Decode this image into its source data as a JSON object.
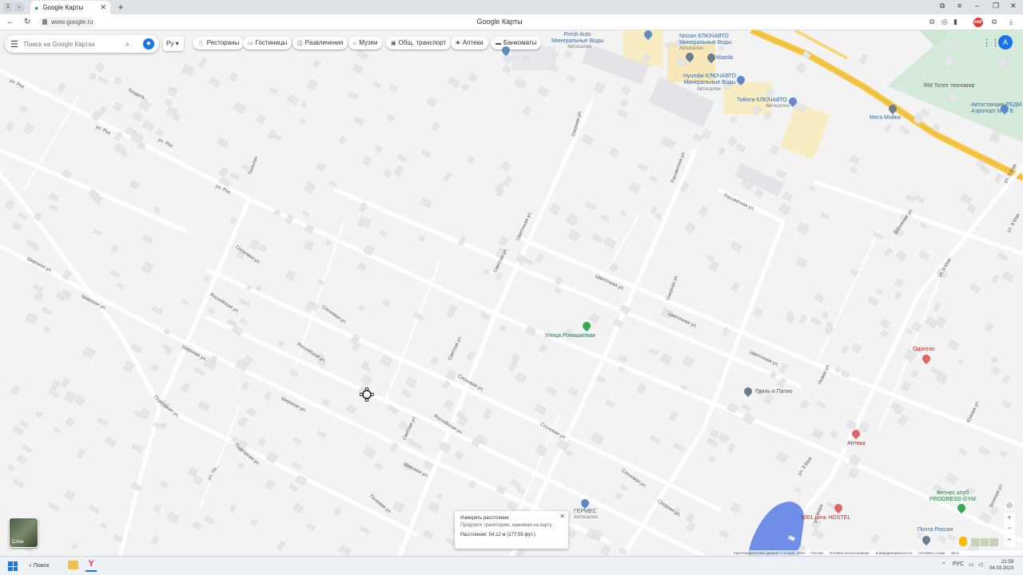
{
  "browser": {
    "tab_count": "1",
    "tab_title": "Google Карты",
    "url": "www.google.ru",
    "page_title": "Google Карты",
    "adblock_label": "ABP"
  },
  "search": {
    "placeholder": "Поиск на Google Картах"
  },
  "language_button": "Ру",
  "chips": [
    {
      "icon": "restaurant-icon",
      "glyph": "🍴",
      "label": "Рестораны"
    },
    {
      "icon": "hotel-icon",
      "glyph": "▭",
      "label": "Гостиницы"
    },
    {
      "icon": "entertainment-icon",
      "glyph": "◫",
      "label": "Развлечения"
    },
    {
      "icon": "museum-icon",
      "glyph": "⌂",
      "label": "Музеи"
    },
    {
      "icon": "transit-icon",
      "glyph": "▣",
      "label": "Общ. транспорт"
    },
    {
      "icon": "pharmacy-icon",
      "glyph": "✚",
      "label": "Аптеки"
    },
    {
      "icon": "atm-icon",
      "glyph": "▬",
      "label": "Банкоматы"
    }
  ],
  "account_initial": "A",
  "pois": {
    "fresh_auto": "Fresh Auto\nМинеральные Воды",
    "fresh_auto_sub": "Автосалон",
    "nissan": "Nissan КЛЮЧАВТО\nМинеральные Воды",
    "nissan_sub": "Автосалон",
    "mazda": "Mazda",
    "hyundai": "Hyundai КЛЮЧАВТО\nМинеральные Воды",
    "hyundai_sub": "Автосалон",
    "toyota": "Тойота КЛЮЧАВТО",
    "toyota_sub": "Автосалон",
    "mega_moika": "Мега Мойка",
    "rm_totek": "RM Тотех техномир",
    "avtostancia": "Автостанция РЕДМ\nАэропорт Мин В",
    "romashkovaya": "Улица Ромашковая",
    "odontis": "Одонтис",
    "gril": "Гриль и Патио",
    "apteka": "Аптека",
    "germes": "ГЕРМЕС",
    "germes_sub": "Автосалон",
    "hostel": "1001 ночь HOSTEL",
    "fitness": "Фитнес клуб\nPROGRESS-GYM",
    "pochta": "Почта России"
  },
  "streets": {
    "roz1": "ул. Роз",
    "roz2": "ул. Роз",
    "roz3": "ул. Роз",
    "roz4": "ул. Роз",
    "tendel": "Тендель...",
    "tulip": "Тюльпан",
    "sosnovaya1": "Сосновая ул.",
    "sosnovaya2": "Сосновая ул.",
    "sosnovaya3": "Сосновая ул.",
    "sosnovaya4": "Сосновая ул.",
    "sosnovaya5": "Сосновая ул.",
    "rossiyskaya1": "Российская ул.",
    "rossiyskaya2": "Российская ул.",
    "rossiyskaya3": "Российская ул.",
    "shirokaya1": "Широкая ул.",
    "shirokaya2": "Широкая ул.",
    "shirokaya3": "Широкая ул.",
    "shirokaya4": "Широкая ул.",
    "svetlaya1": "Светлая ул.",
    "svetlaya2": "Светлая ул.",
    "svetlaya3": "Светлая ул.",
    "cvetochnaya1": "Цветочная ул.",
    "cvetochnaya2": "Цветочная ул.",
    "cvetochnaya3": "Цветочная ул.",
    "cvetochnaya4": "Цветочная ул.",
    "rassvetnaya": "Рассветная ул.",
    "rassvetnaya2": "Рассветная ул.",
    "ozernaya": "Озерная ул.",
    "ozernaya2": "Озерная ул.",
    "podgornaya": "Подгорная ул.",
    "podgornaya2": "Подгорная ул.",
    "polevaya": "Полевая ул.",
    "srednyaya": "Средняя ул.",
    "mira": "ул. Мира",
    "may9_1": "ул. 9 Мая",
    "may9_2": "ул. 9 Мая",
    "may9_3": "ул. 9 Мая",
    "dorozhnaya": "Дорожная ул.",
    "yuzhnaya": "Южная ул.",
    "novaya": "Новая ул.",
    "zelenaya": "Зеленая ул.",
    "ulitsa": "ул. Ла..."
  },
  "measure": {
    "title": "Измерить расстояние",
    "subtitle": "Продлите траекторию, нажимая на карту",
    "distance": "Расстояние: 54,12 м (177,59 фут.)"
  },
  "layers_label": "Слои",
  "footer": {
    "copyright": "Картографические данные © Google, 2023",
    "country": "Россия",
    "terms": "Условия использования",
    "privacy": "Конфиденциальность",
    "feedback": "Оставить отзыв",
    "scale": "50 м"
  },
  "taskbar": {
    "search_label": "Поиск",
    "language": "РУС",
    "time": "21:59",
    "date": "04.03.2023"
  },
  "colors": {
    "map_bg": "#f3f3f4",
    "road": "#ffffff",
    "highway": "#f6c744",
    "water": "#6f8ee8",
    "accent": "#1a73e8"
  }
}
